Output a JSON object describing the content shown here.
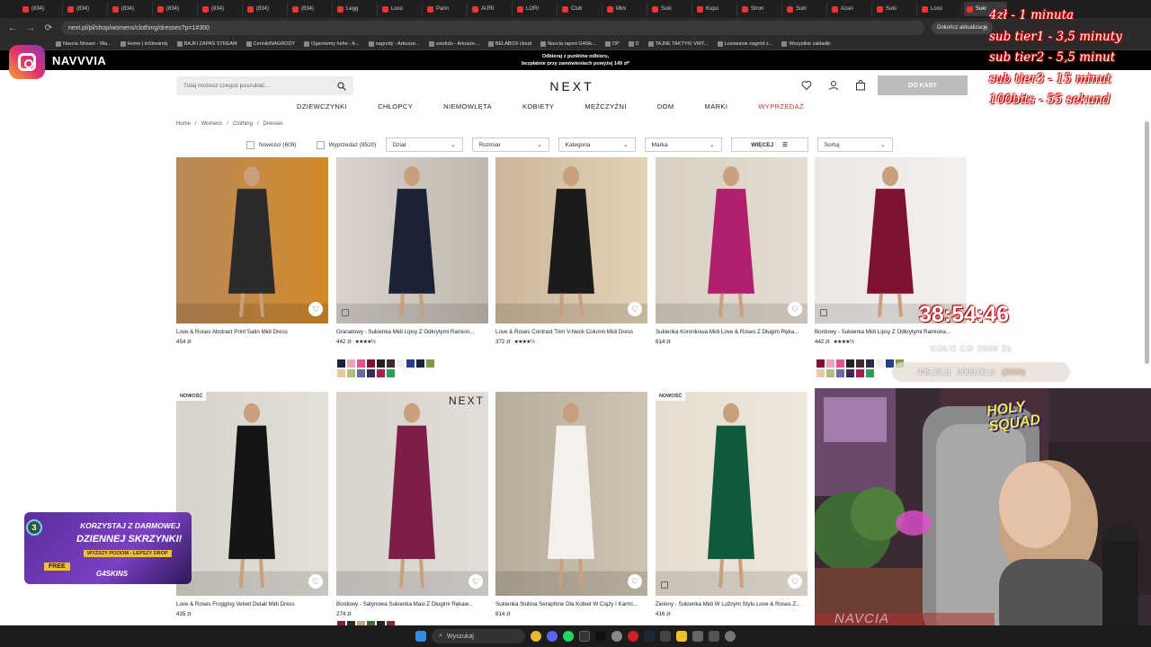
{
  "browser": {
    "tabs": [
      "(834)",
      "(834)",
      "(834)",
      "(834)",
      "(834)",
      "(834)",
      "(834)",
      "Legg",
      "Loso",
      "Parin",
      "AURI",
      "LORI",
      "Club",
      "Mini",
      "Suki",
      "Kupu",
      "Stron",
      "Suki",
      "Azari",
      "Suki",
      "Loso",
      "Suki"
    ],
    "url": "next.pl/pl/shop/womens/clothing/dresses?p=1#300",
    "update_label": "Dokończ aktualizację",
    "bookmarks": [
      "Navcia Stream - Wa...",
      "Home | inStreamly",
      "BAJKI ZAPAS STREAM",
      "Cennik/NAGRODY",
      "Ogarniemy hehe - A...",
      "nagrody - Arkusze...",
      "uwufufu - Arkusze...",
      "BELABOX cloud",
      "Navcia raport G4Ski...",
      "DP",
      "D",
      "TAJNE TAKTYKI VIRT...",
      "Losowanie nagród z...",
      "Wszystkie zakładki"
    ]
  },
  "promo": {
    "line1": "Odbieraj z punktów odbioru,",
    "line2": "bezpłatnie przy zamówieniach powyżej 149 zł*"
  },
  "header": {
    "search_placeholder": "Tutaj możesz czegoś poszukać...",
    "logo": "NEXT",
    "checkout": "DO KASY"
  },
  "nav": [
    "DZIEWCZYNKI",
    "CHŁOPCY",
    "NIEMOWLĘTA",
    "KOBIETY",
    "MĘŻCZYŹNI",
    "DOM",
    "MARKI",
    "WYPRZEDAŻ"
  ],
  "breadcrumb": [
    "Home",
    "/",
    "Womens",
    "/",
    "Clothing",
    "/",
    "Dresses"
  ],
  "filters": {
    "new": "Nowości (609)",
    "sale": "Wyprzedaż (8520)",
    "selects": [
      "Dział",
      "Rozmiar",
      "Kategoria",
      "Marka"
    ],
    "more": "WIĘCEJ",
    "sort": "Sortuj"
  },
  "products": [
    {
      "title": "Love & Roses Abstract Print Satin Midi Dress",
      "price": "454 zł",
      "stars": ""
    },
    {
      "title": "Granatowy - Sukienka Midi Lipsy Z Odkrytymi Ramion...",
      "price": "442 zł",
      "stars": "★★★★½"
    },
    {
      "title": "Love & Roses Contrast Trim V-Neck Column Midi Dress",
      "price": "372 zł",
      "stars": "★★★★½"
    },
    {
      "title": "Sukienka Koronkowa Midi Love & Roses Z Długim Ręka...",
      "price": "814 zł",
      "stars": ""
    },
    {
      "title": "Bordowy - Sukienka Midi Lipsy Z Odkrytymi Ramiona...",
      "price": "442 zł",
      "stars": "★★★★½"
    },
    {
      "title": "Love & Roses Frogging Velvet Detail Midi Dress",
      "price": "435 zł",
      "stars": "",
      "badge": "NOWOŚĆ"
    },
    {
      "title": "Bordowy - Satynowa Sukienka Maxi Z Długimi Rękaw...",
      "price": "274 zł",
      "stars": "",
      "badge": "",
      "brand": "NEXT"
    },
    {
      "title": "Sukienka Ślubna Seraphine Dla Kobiet W Ciąży I Karmi...",
      "price": "814 zł",
      "stars": ""
    },
    {
      "title": "Zielony - Sukienka Midi W Luźnym Stylu Love & Roses Z...",
      "price": "416 zł",
      "stars": "",
      "badge": "NOWOŚĆ"
    }
  ],
  "stream": {
    "instagram": "NAVVVIA",
    "subs": [
      "4zł - 1 minuta",
      "sub tier1 - 3,5 minuty",
      "sub tier2 - 5,5 minut",
      "sub tier3 - 15 minut",
      "100bits - 55 sekund"
    ],
    "timer": "38:54:46",
    "goal_label": "KOŁO CO 2000 ZŁ",
    "goal_current": "435,73 zł",
    "goal_target": "2000,00 zł",
    "goal_total": "(2000)",
    "ad_line1": "KORZYSTAJ Z DARMOWEJ",
    "ad_line2": "DZIENNEJ SKRZYNKI!",
    "ad_line3": "WYŻSZY POZIOM - LEPSZY DROP",
    "ad_free": "FREE",
    "ad_brand": "G4SKINS",
    "ad_level": "3",
    "cam_sign": "HOLY SQUAD",
    "cam_name": "NAVCIA"
  },
  "taskbar": {
    "search": "Wyszukaj"
  }
}
